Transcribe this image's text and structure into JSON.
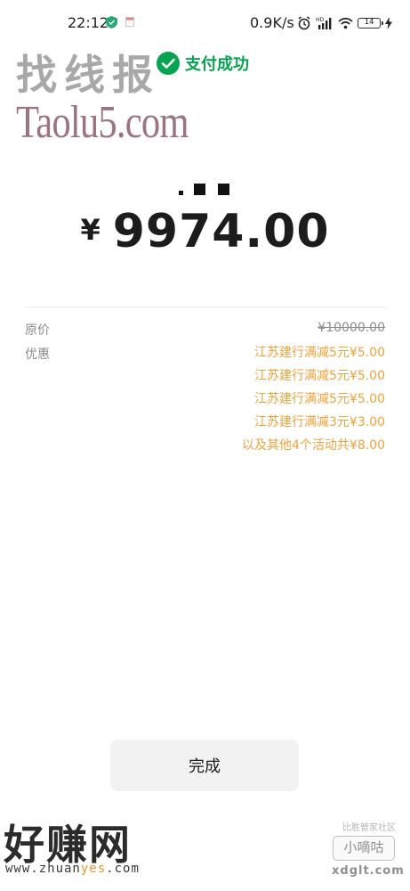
{
  "status_bar": {
    "time": "22:12",
    "net_speed": "0.9K/s",
    "battery": "14",
    "icons": [
      "shield-icon",
      "flag-icon",
      "alarm-icon",
      "hd-signal-icon",
      "wifi-icon",
      "battery-icon",
      "charging-icon"
    ]
  },
  "watermarks": {
    "top_cn": "找线报",
    "top_en": "Taolu5.com",
    "bottom_cn": "好赚网",
    "bottom_url_pre": "www.zhuan",
    "bottom_url_mid": "yes",
    "bottom_url_post": ".com",
    "br_top": "比胜管家社区",
    "br_box": "小嘀咕",
    "br_domain": "xdglt.com"
  },
  "header": {
    "success_text": "支付成功"
  },
  "amount": {
    "currency_symbol": "¥",
    "value": "9974.00"
  },
  "details": {
    "original_label": "原价",
    "original_value": "¥10000.00",
    "discount_label": "优惠",
    "discounts": [
      "江苏建行满减5元¥5.00",
      "江苏建行满减5元¥5.00",
      "江苏建行满减5元¥5.00",
      "江苏建行满减3元¥3.00",
      "以及其他4个活动共¥8.00"
    ]
  },
  "actions": {
    "done_label": "完成"
  },
  "colors": {
    "success_green": "#07a351",
    "discount_orange": "#f0a23a",
    "muted_gray": "#8c8c8c",
    "button_bg": "#f2f2f2"
  }
}
